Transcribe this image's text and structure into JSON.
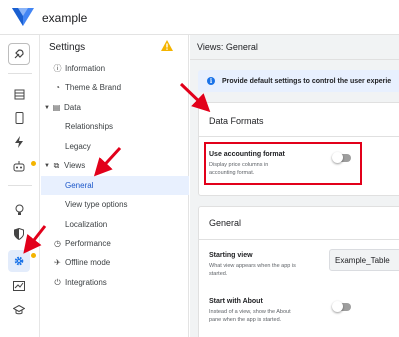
{
  "app": {
    "name": "example"
  },
  "rail": {
    "items": [
      {
        "name": "rocket-icon",
        "glyph": "⚐"
      },
      {
        "name": "table-icon",
        "glyph": "▤"
      },
      {
        "name": "phone-icon",
        "glyph": "▯"
      },
      {
        "name": "bolt-icon",
        "glyph": "ϟ"
      },
      {
        "name": "robot-icon",
        "glyph": "◍"
      },
      {
        "name": "bulb-icon",
        "glyph": "◌"
      },
      {
        "name": "shield-icon",
        "glyph": "◈"
      },
      {
        "name": "settings-gear-icon",
        "glyph": "⚙"
      },
      {
        "name": "monitor-chart-icon",
        "glyph": "▭"
      },
      {
        "name": "graduation-cap-icon",
        "glyph": "◆"
      }
    ]
  },
  "nav": {
    "header": "Settings",
    "items": {
      "information": "Information",
      "theme_brand": "Theme & Brand",
      "data": "Data",
      "relationships": "Relationships",
      "legacy": "Legacy",
      "views": "Views",
      "general": "General",
      "view_type_options": "View type options",
      "localization": "Localization",
      "performance": "Performance",
      "offline_mode": "Offline mode",
      "integrations": "Integrations"
    }
  },
  "main": {
    "page_title": "Views: General",
    "info_banner": "Provide default settings to control the user experie",
    "data_formats": {
      "title": "Data Formats",
      "use_accounting_format": {
        "label": "Use accounting format",
        "description_line1": "Display price columns in",
        "description_line2": "accounting format.",
        "enabled": false
      }
    },
    "general": {
      "title": "General",
      "starting_view": {
        "label": "Starting view",
        "description_line1": "What view appears when the app is",
        "description_line2": "started.",
        "value": "Example_Table"
      },
      "start_with_about": {
        "label": "Start with About",
        "description_line1": "Instead of a view, show the About",
        "description_line2": "pane when the app is started.",
        "enabled": false
      }
    }
  },
  "colors": {
    "accent": "#1a73e8",
    "annotation": "#e2001a",
    "warning": "#f4b400"
  }
}
